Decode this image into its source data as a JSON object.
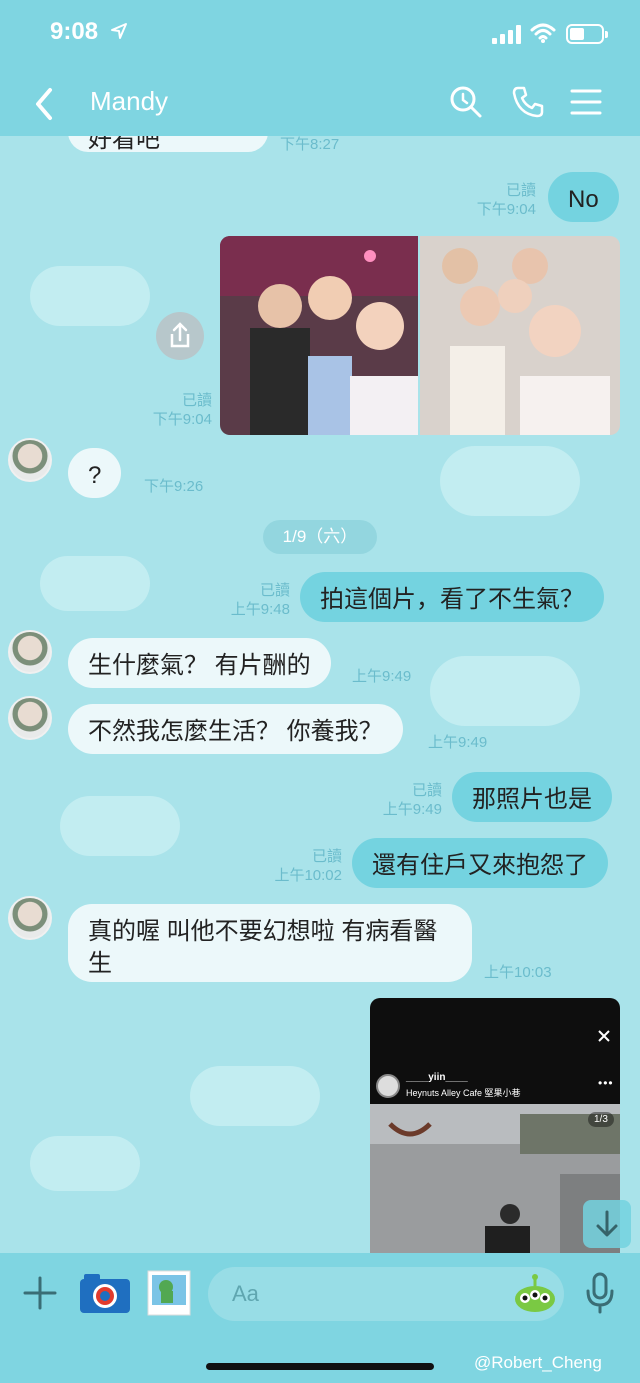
{
  "status": {
    "time": "9:08"
  },
  "header": {
    "title": "Mandy"
  },
  "messages": {
    "m0_text": "好看吧",
    "m0_time": "下午8:27",
    "m1_read": "已讀",
    "m1_time": "下午9:04",
    "m1_text": "No",
    "m2_read": "已讀",
    "m2_time": "下午9:04",
    "m3_text": "?",
    "m3_time": "下午9:26",
    "date_divider": "1/9（六）",
    "m4_read": "已讀",
    "m4_time": "上午9:48",
    "m4_text": "拍這個片，看了不生氣？",
    "m5_text": "生什麼氣？ 有片酬的",
    "m5_time": "上午9:49",
    "m6_text": "不然我怎麼生活？ 你養我？",
    "m6_time": "上午9:49",
    "m7_read": "已讀",
    "m7_time": "上午9:49",
    "m7_text": "那照片也是",
    "m8_read": "已讀",
    "m8_time": "上午10:02",
    "m8_text": "還有住戶又來抱怨了",
    "m9_line1": "真的喔 叫他不要幻想啦 有病看醫",
    "m9_line2": "生",
    "m9_time": "上午10:03",
    "story_user": "____yiin____",
    "story_place": "Heynuts Alley Cafe 堅果小巷",
    "story_counter": "1/3"
  },
  "composer": {
    "placeholder": "Aa"
  },
  "watermark": "@Robert_Cheng",
  "colors": {
    "header": "#7fd5e1",
    "background": "#a9e3ea",
    "outgoing": "#74d3e0",
    "incoming": "#ecf8fa"
  }
}
